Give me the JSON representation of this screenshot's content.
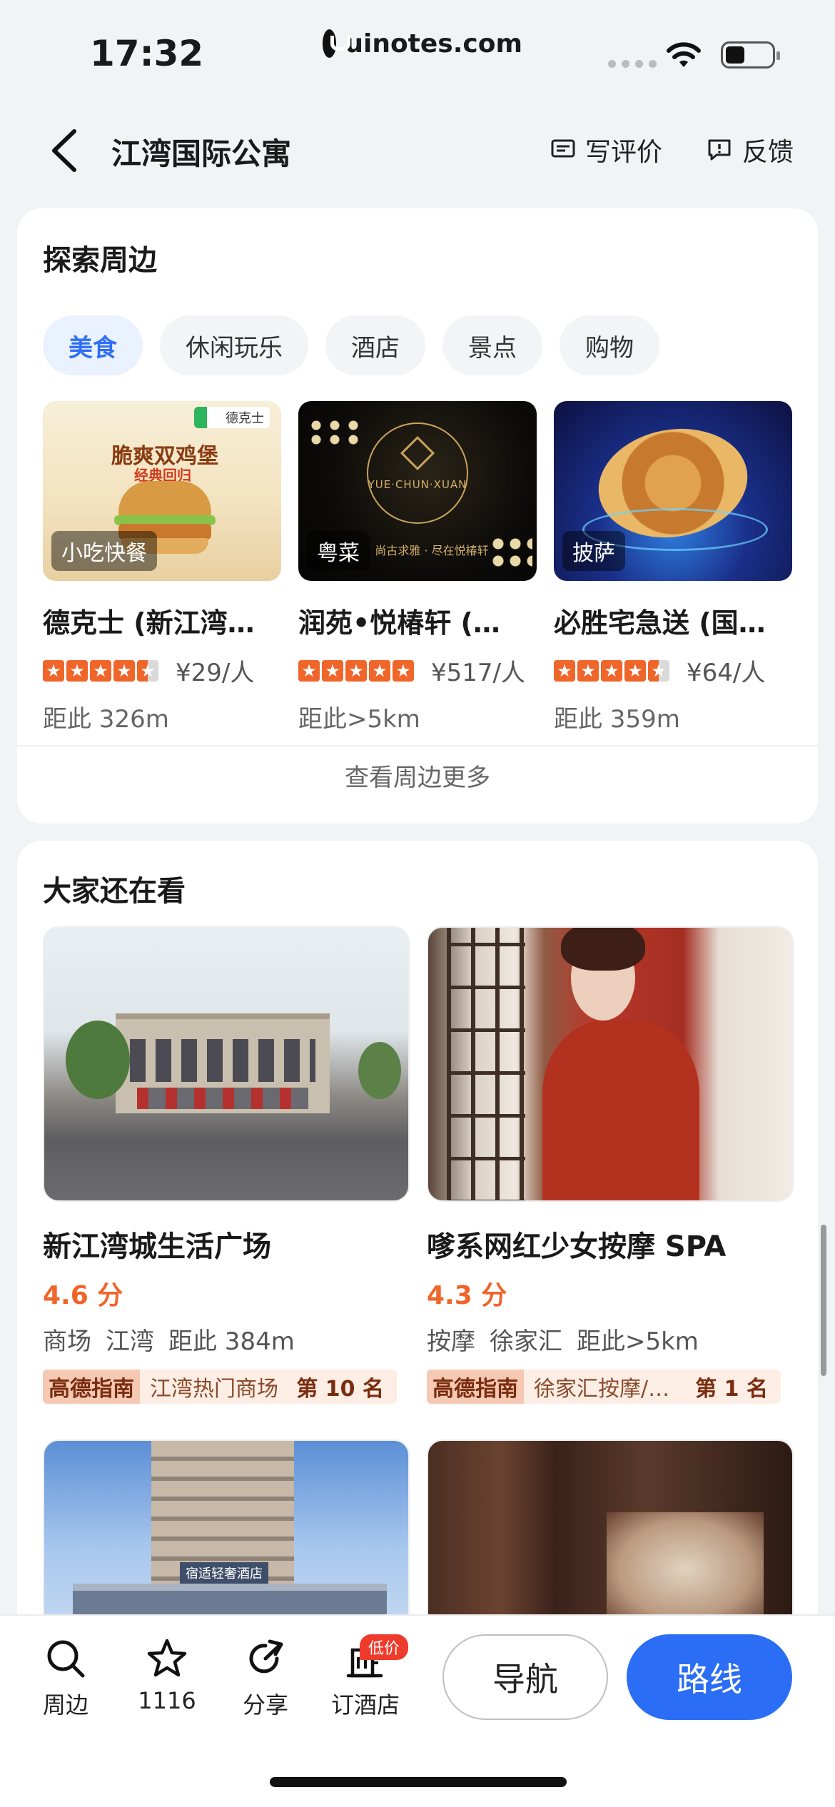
{
  "status_bar": {
    "time": "17:32",
    "url": "uinotes.com"
  },
  "nav": {
    "title": "江湾国际公寓",
    "write_review": "写评价",
    "feedback": "反馈"
  },
  "explore": {
    "title": "探索周边",
    "chips": [
      "美食",
      "休闲玩乐",
      "酒店",
      "景点",
      "购物"
    ],
    "active_chip": "美食",
    "items": [
      {
        "tag": "小吃快餐",
        "name": "德克士 (新江湾…",
        "rating": 4.5,
        "price": "¥29/人",
        "distance": "距此 326m",
        "banner_text": "脆爽双鸡堡",
        "banner_sub": "经典回归",
        "brand": "德克士"
      },
      {
        "tag": "粤菜",
        "name": "润苑•悦椿轩 (…",
        "rating": 5,
        "price": "¥517/人",
        "distance": "距此>5km",
        "logo_text": "YUE·CHUN·XUAN",
        "slogan": "尚古求雅 · 尽在悦椿轩"
      },
      {
        "tag": "披萨",
        "name": "必胜宅急送 (国…",
        "rating": 4.5,
        "price": "¥64/人",
        "distance": "距此 359m"
      }
    ],
    "see_more": "查看周边更多"
  },
  "also_watching": {
    "title": "大家还在看",
    "items": [
      {
        "name": "新江湾城生活广场",
        "score": "4.6 分",
        "category": "商场",
        "area": "江湾",
        "distance": "距此 384m",
        "guide_label": "高德指南",
        "guide_text": "江湾热门商场",
        "guide_rank": "第 10 名"
      },
      {
        "name": "嗲系网红少女按摩 SPA",
        "score": "4.3 分",
        "category": "按摩",
        "area": "徐家汇",
        "distance": "距此>5km",
        "guide_label": "高德指南",
        "guide_text": "徐家汇按摩/…",
        "guide_rank": "第 1 名"
      },
      {
        "name": "",
        "hotel_sign": "宿适轻奢酒店"
      },
      {
        "name": ""
      }
    ]
  },
  "bottom_bar": {
    "tabs": [
      {
        "label": "周边",
        "icon": "search-icon"
      },
      {
        "label": "1116",
        "icon": "star-icon"
      },
      {
        "label": "分享",
        "icon": "share-icon"
      },
      {
        "label": "订酒店",
        "icon": "hotel-icon"
      }
    ],
    "low_price_badge": "低价",
    "navigate": "导航",
    "route": "路线"
  },
  "colors": {
    "accent": "#2b6ef5",
    "rating": "#f0652a",
    "badge_red": "#ee3b2b"
  }
}
